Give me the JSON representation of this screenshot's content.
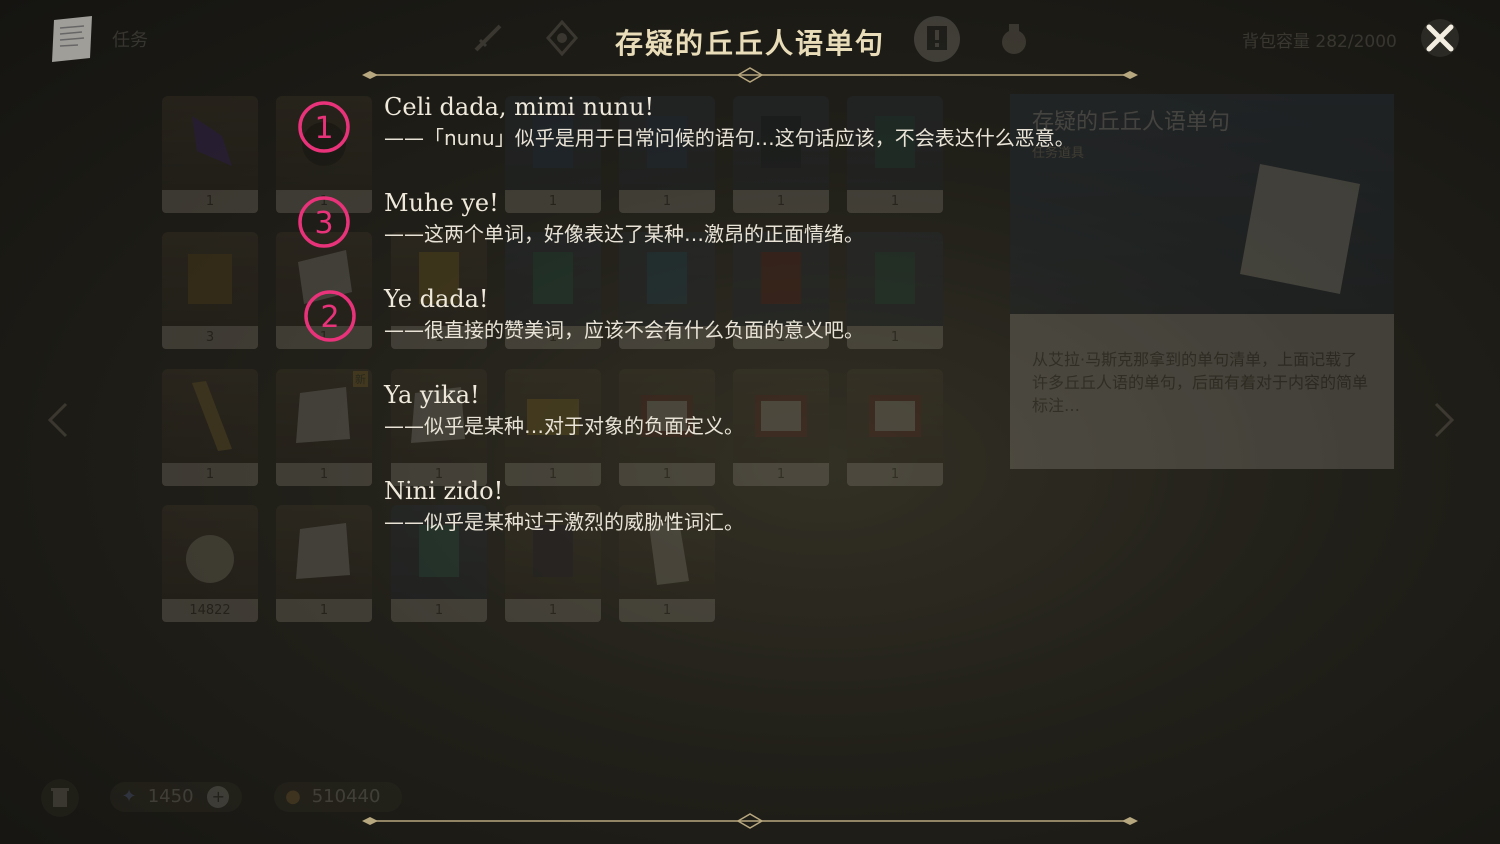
{
  "top_bar": {
    "quest_label": "任务",
    "capacity_label": "背包容量",
    "capacity_value": "282/2000"
  },
  "tabs": [
    {
      "icon": "sword-icon"
    },
    {
      "icon": "artifact-icon"
    },
    {
      "icon": "quest-item-icon",
      "active": true
    },
    {
      "icon": "bag-icon"
    }
  ],
  "grid": {
    "rows": [
      [
        {
          "icon": "crystal-icon",
          "count": "1"
        },
        {
          "icon": "relic-icon",
          "count": "1"
        },
        {
          "icon": "book-icon",
          "count": "1"
        },
        {
          "icon": "book-icon",
          "count": "1"
        },
        {
          "icon": "book-icon",
          "count": "1"
        },
        {
          "icon": "book-icon",
          "count": "1"
        }
      ],
      [
        {
          "icon": "book-icon",
          "count": "3"
        },
        {
          "icon": "paper-icon",
          "count": "1"
        },
        {
          "icon": "book-icon",
          "count": "1"
        },
        {
          "icon": "book-icon",
          "count": "1"
        },
        {
          "icon": "book-icon",
          "count": "1"
        },
        {
          "icon": "book-icon",
          "count": "1"
        },
        {
          "icon": "book-icon",
          "count": "1"
        }
      ],
      [
        {
          "icon": "scroll-icon",
          "count": "1"
        },
        {
          "icon": "paper-icon",
          "count": "1",
          "badge": "新"
        },
        {
          "icon": "paper-icon",
          "count": "1"
        },
        {
          "icon": "chest-icon",
          "count": "1"
        },
        {
          "icon": "letter-icon",
          "count": "1"
        },
        {
          "icon": "letter-icon",
          "count": "1"
        },
        {
          "icon": "letter-icon",
          "count": "1"
        }
      ],
      [
        {
          "icon": "bag-item-icon",
          "count": "14822"
        },
        {
          "icon": "paper-icon",
          "count": "1"
        },
        {
          "icon": "book-icon",
          "count": "1"
        },
        {
          "icon": "book-icon",
          "count": "1"
        },
        {
          "icon": "paper-icon",
          "count": "1"
        }
      ]
    ]
  },
  "detail": {
    "title": "存疑的丘丘人语单句",
    "subtitle": "任务道具",
    "description": "从艾拉·马斯克那拿到的单句清单，上面记载了许多丘丘人语的单句，后面有着对于内容的简单标注…"
  },
  "bottom": {
    "primogem_value": "1450",
    "mora_value": "510440"
  },
  "overlay": {
    "title": "存疑的丘丘人语单句",
    "entries": [
      {
        "phrase": "Celi dada, mimi nunu!",
        "note": "——「nunu」似乎是用于日常问候的语句…这句话应该，不会表达什么恶意。"
      },
      {
        "phrase": "Muhe ye!",
        "note": "——这两个单词，好像表达了某种…激昂的正面情绪。"
      },
      {
        "phrase": "Ye dada!",
        "note": "——很直接的赞美词，应该不会有什么负面的意义吧。"
      },
      {
        "phrase": "Ya yika!",
        "note": "——似乎是某种…对于对象的负面定义。"
      },
      {
        "phrase": "Nini zido!",
        "note": "——似乎是某种过于激烈的威胁性词汇。"
      }
    ],
    "markers": [
      "①",
      "③",
      "②"
    ],
    "marker_color": "#e8327a"
  }
}
